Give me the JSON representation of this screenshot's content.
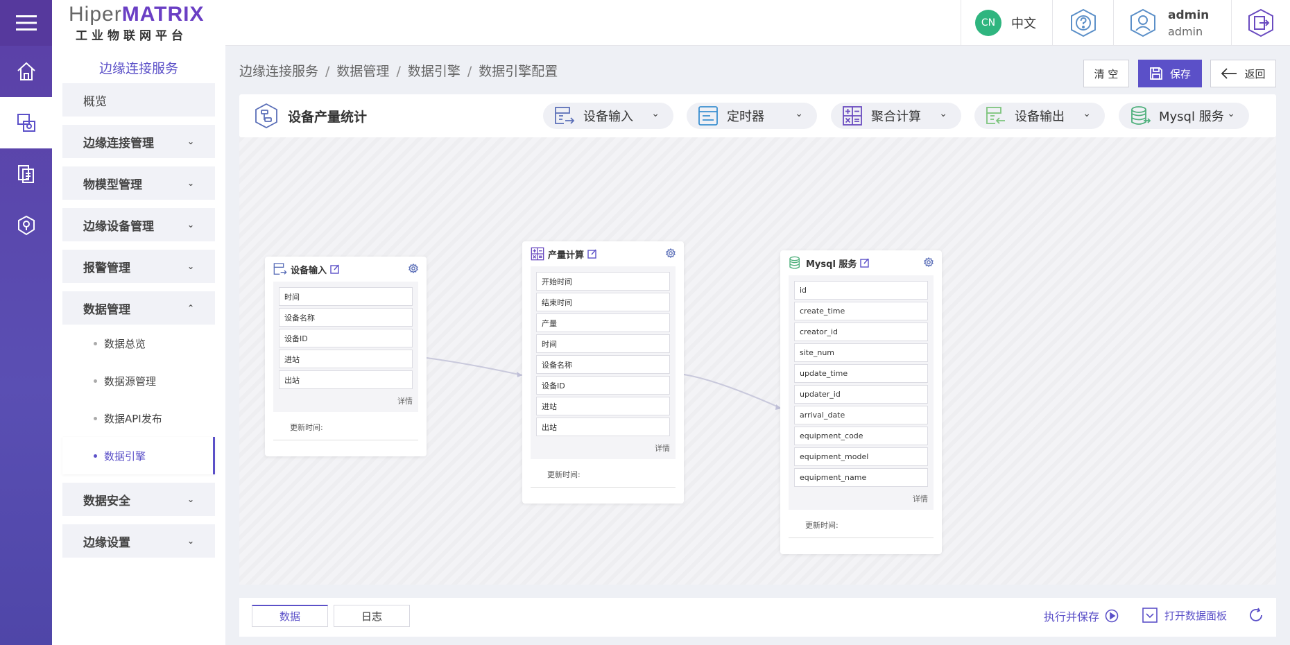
{
  "app": {
    "logo_left": "Hiper",
    "logo_right": "MATRIX",
    "logo_subtitle": "工业物联网平台"
  },
  "colors": {
    "accent": "#5b50c8",
    "rail": "#5a43a8",
    "cn_badge": "#2fb57f"
  },
  "topbar": {
    "lang_badge": "CN",
    "lang_label": "中文",
    "user_name": "admin",
    "user_role": "admin"
  },
  "sidebar": {
    "title": "边缘连接服务",
    "overview": "概览",
    "groups": [
      {
        "label": "边缘连接管理"
      },
      {
        "label": "物模型管理"
      },
      {
        "label": "边缘设备管理"
      },
      {
        "label": "报警管理"
      },
      {
        "label": "数据管理"
      }
    ],
    "sub_items": [
      "数据总览",
      "数据源管理",
      "数据API发布",
      "数据引擎"
    ],
    "groups_after": [
      {
        "label": "数据安全"
      },
      {
        "label": "边缘设置"
      }
    ]
  },
  "breadcrumb": [
    "边缘连接服务",
    "数据管理",
    "数据引擎",
    "数据引擎配置"
  ],
  "buttons": {
    "clear": "清 空",
    "save": "保存",
    "back": "返回"
  },
  "toolbar": {
    "title": "设备产量统计",
    "tools": [
      "设备输入",
      "定时器",
      "聚合计算",
      "设备输出",
      "Mysql 服务"
    ]
  },
  "nodes": [
    {
      "title": "设备输入",
      "fields": [
        "时间",
        "设备名称",
        "设备ID",
        "进站",
        "出站"
      ],
      "detail": "详情",
      "updated": "更新时间:"
    },
    {
      "title": "产量计算",
      "fields": [
        "开始时间",
        "结束时间",
        "产量",
        "时间",
        "设备名称",
        "设备ID",
        "进站",
        "出站"
      ],
      "detail": "详情",
      "updated": "更新时间:"
    },
    {
      "title": "Mysql 服务",
      "fields": [
        "id",
        "create_time",
        "creator_id",
        "site_num",
        "update_time",
        "updater_id",
        "arrival_date",
        "equipment_code",
        "equipment_model",
        "equipment_name"
      ],
      "detail": "详情",
      "updated": "更新时间:"
    }
  ],
  "bottom": {
    "tabs": [
      "数据",
      "日志"
    ],
    "run_save": "执行并保存",
    "open_panel": "打开数据面板"
  }
}
